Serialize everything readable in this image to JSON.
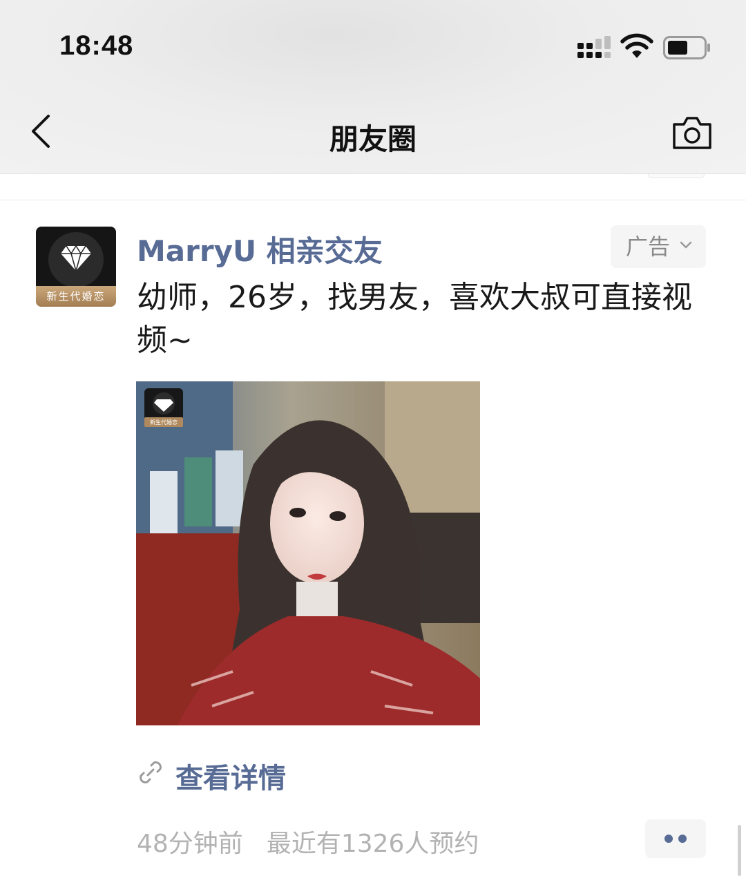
{
  "status_bar": {
    "time": "18:48"
  },
  "nav": {
    "title": "朋友圈"
  },
  "post": {
    "avatar_caption": "新生代婚恋",
    "poster_name": "MarryU 相亲交友",
    "ad_label": "广告",
    "text": "幼师，26岁，找男友，喜欢大叔可直接视频~",
    "image_badge_caption": "新生代婚恋",
    "link_text": "查看详情",
    "time_ago": "48分钟前",
    "booking_count": "最近有1326人预约"
  },
  "colors": {
    "link": "#576b95",
    "meta": "#b2b2b2",
    "background": "#ffffff"
  }
}
